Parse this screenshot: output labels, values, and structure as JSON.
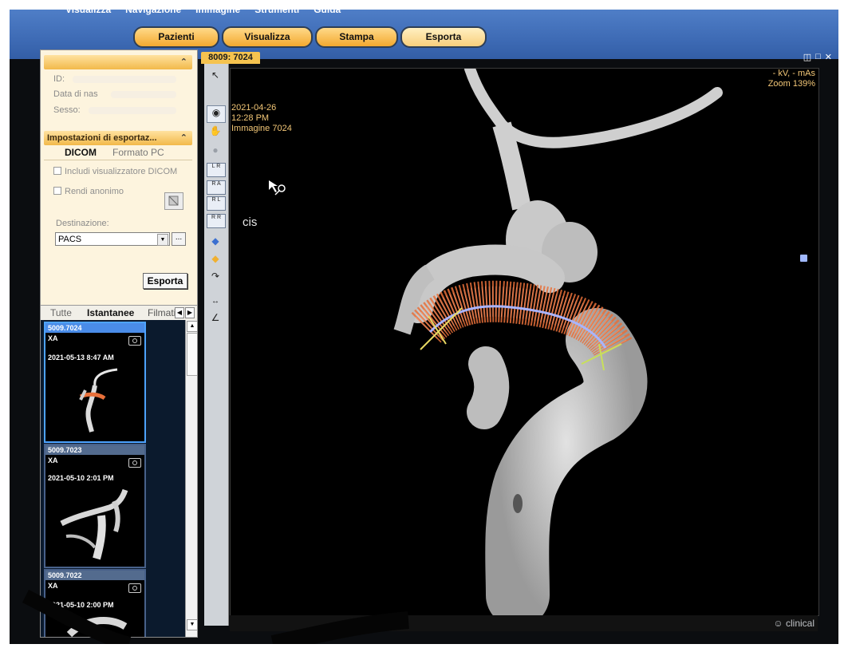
{
  "menu": [
    "Visualizza",
    "Navigazione",
    "Immagine",
    "Strumenti",
    "Guida"
  ],
  "tabs": [
    {
      "label": "Pazienti"
    },
    {
      "label": "Visualizza"
    },
    {
      "label": "Stampa"
    },
    {
      "label": "Esporta"
    }
  ],
  "patient": {
    "id_label": "ID:",
    "dob_label": "Data di nas",
    "sex_label": "Sesso:"
  },
  "export": {
    "header": "Impostazioni di esportaz...",
    "subtab_dicom": "DICOM",
    "subtab_pc": "Formato PC",
    "include_viewer": "Includi visualizzatore DICOM",
    "anonymize": "Rendi anonimo",
    "destination_label": "Destinazione:",
    "destination_value": "PACS",
    "browse_label": "...",
    "export_button": "Esporta"
  },
  "thumb_tabs": [
    "Tutte",
    "Istantanee",
    "Filmati"
  ],
  "thumbnails": [
    {
      "id": "5009.7024",
      "modality": "XA",
      "date": "2021-05-13 8:47 AM"
    },
    {
      "id": "5009.7023",
      "modality": "XA",
      "date": "2021-05-10 2:01 PM"
    },
    {
      "id": "5009.7022",
      "modality": "XA",
      "date": "2021-05-10 2:00 PM"
    }
  ],
  "viewport": {
    "tab": "8009: 7024",
    "date": "2021-04-26",
    "time": "12:28 PM",
    "image": "Immagine 7024",
    "kv_mas": "- kV, - mAs",
    "zoom": "Zoom 139%",
    "orientation_label": "cis"
  },
  "status": {
    "text": "clinical"
  },
  "colors": {
    "accent_tab": "#f5c34f",
    "band": "#3e6bb5",
    "overlay_text": "#f3c777",
    "stent_mesh": "#e8703a"
  }
}
